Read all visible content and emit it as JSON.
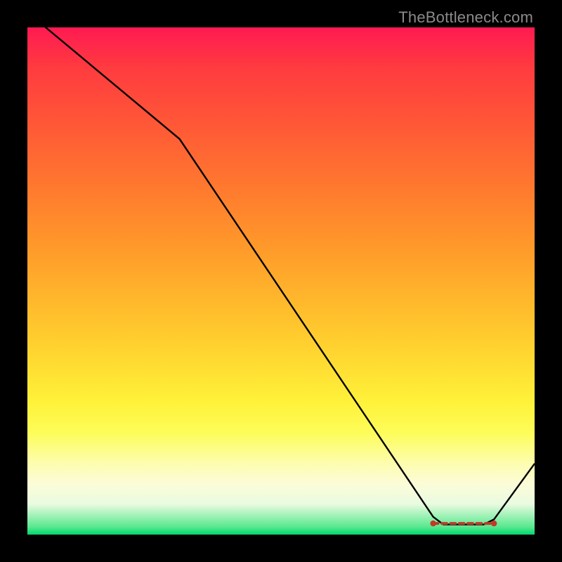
{
  "watermark": "TheBottleneck.com",
  "chart_data": {
    "type": "line",
    "title": "",
    "xlabel": "",
    "ylabel": "",
    "xlim": [
      0,
      100
    ],
    "ylim": [
      0,
      100
    ],
    "series": [
      {
        "name": "curve",
        "x": [
          0,
          30,
          80,
          82,
          90,
          92,
          100
        ],
        "values": [
          103,
          78,
          3.5,
          2.0,
          2.0,
          3.0,
          14
        ]
      }
    ],
    "marker_band": {
      "x_start": 80,
      "x_end": 92,
      "y": 2.2
    },
    "background_gradient": {
      "top": "#ff1a52",
      "middle": "#ffd830",
      "bottom": "#00d86f"
    }
  }
}
